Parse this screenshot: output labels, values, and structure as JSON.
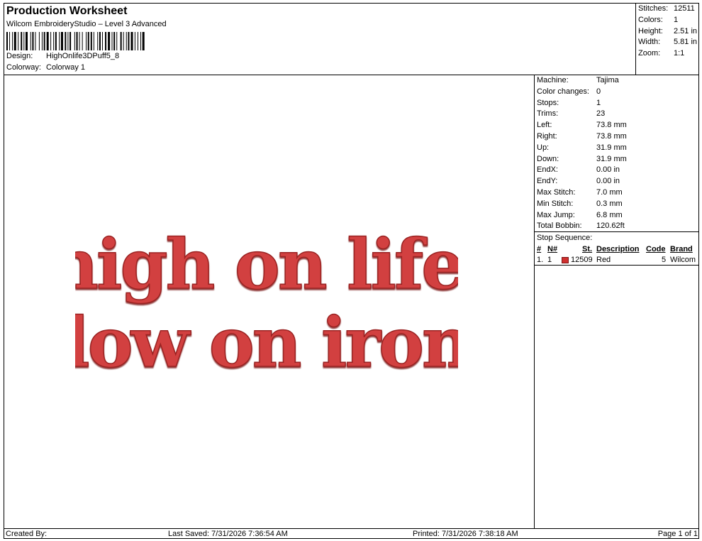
{
  "header": {
    "title": "Production Worksheet",
    "subtitle": "Wilcom EmbroideryStudio – Level 3 Advanced",
    "design_label": "Design:",
    "design_value": "HighOnlife3DPuff5_8",
    "colorway_label": "Colorway:",
    "colorway_value": "Colorway 1"
  },
  "topstats": [
    {
      "label": "Stitches:",
      "value": "12511"
    },
    {
      "label": "Colors:",
      "value": "1"
    },
    {
      "label": "Height:",
      "value": "2.51 in"
    },
    {
      "label": "Width:",
      "value": "5.81 in"
    },
    {
      "label": "Zoom:",
      "value": "1:1"
    }
  ],
  "specs": [
    {
      "label": "Machine:",
      "value": "Tajima"
    },
    {
      "label": "Color changes:",
      "value": "0"
    },
    {
      "label": "Stops:",
      "value": "1"
    },
    {
      "label": "Trims:",
      "value": "23"
    },
    {
      "label": "Left:",
      "value": "73.8 mm"
    },
    {
      "label": "Right:",
      "value": "73.8 mm"
    },
    {
      "label": "Up:",
      "value": "31.9 mm"
    },
    {
      "label": "Down:",
      "value": "31.9 mm"
    },
    {
      "label": "EndX:",
      "value": "0.00 in"
    },
    {
      "label": "EndY:",
      "value": "0.00 in"
    },
    {
      "label": "Max Stitch:",
      "value": "7.0 mm"
    },
    {
      "label": "Min Stitch:",
      "value": "0.3 mm"
    },
    {
      "label": "Max Jump:",
      "value": "6.8 mm"
    },
    {
      "label": "Total Bobbin:",
      "value": "120.62ft"
    }
  ],
  "stop_sequence": {
    "title": "Stop Sequence:",
    "headers": {
      "num": "#",
      "needle": "N#",
      "stitches": "St.",
      "description": "Description",
      "code": "Code",
      "brand": "Brand"
    },
    "rows": [
      {
        "num": "1.",
        "needle": "1",
        "stitches": "12509",
        "description": "Red",
        "code": "5",
        "brand": "Wilcom",
        "color": "#d0302f"
      }
    ]
  },
  "artwork": {
    "line1": "high on life,",
    "line2": "low on iron",
    "fill_color": "#d2413f",
    "shade_color": "#9a2422"
  },
  "footer": {
    "created_by": "Created By:",
    "last_saved": "Last Saved: 7/31/2026 7:36:54 AM",
    "printed": "Printed: 7/31/2026 7:38:18 AM",
    "page": "Page 1 of 1"
  }
}
